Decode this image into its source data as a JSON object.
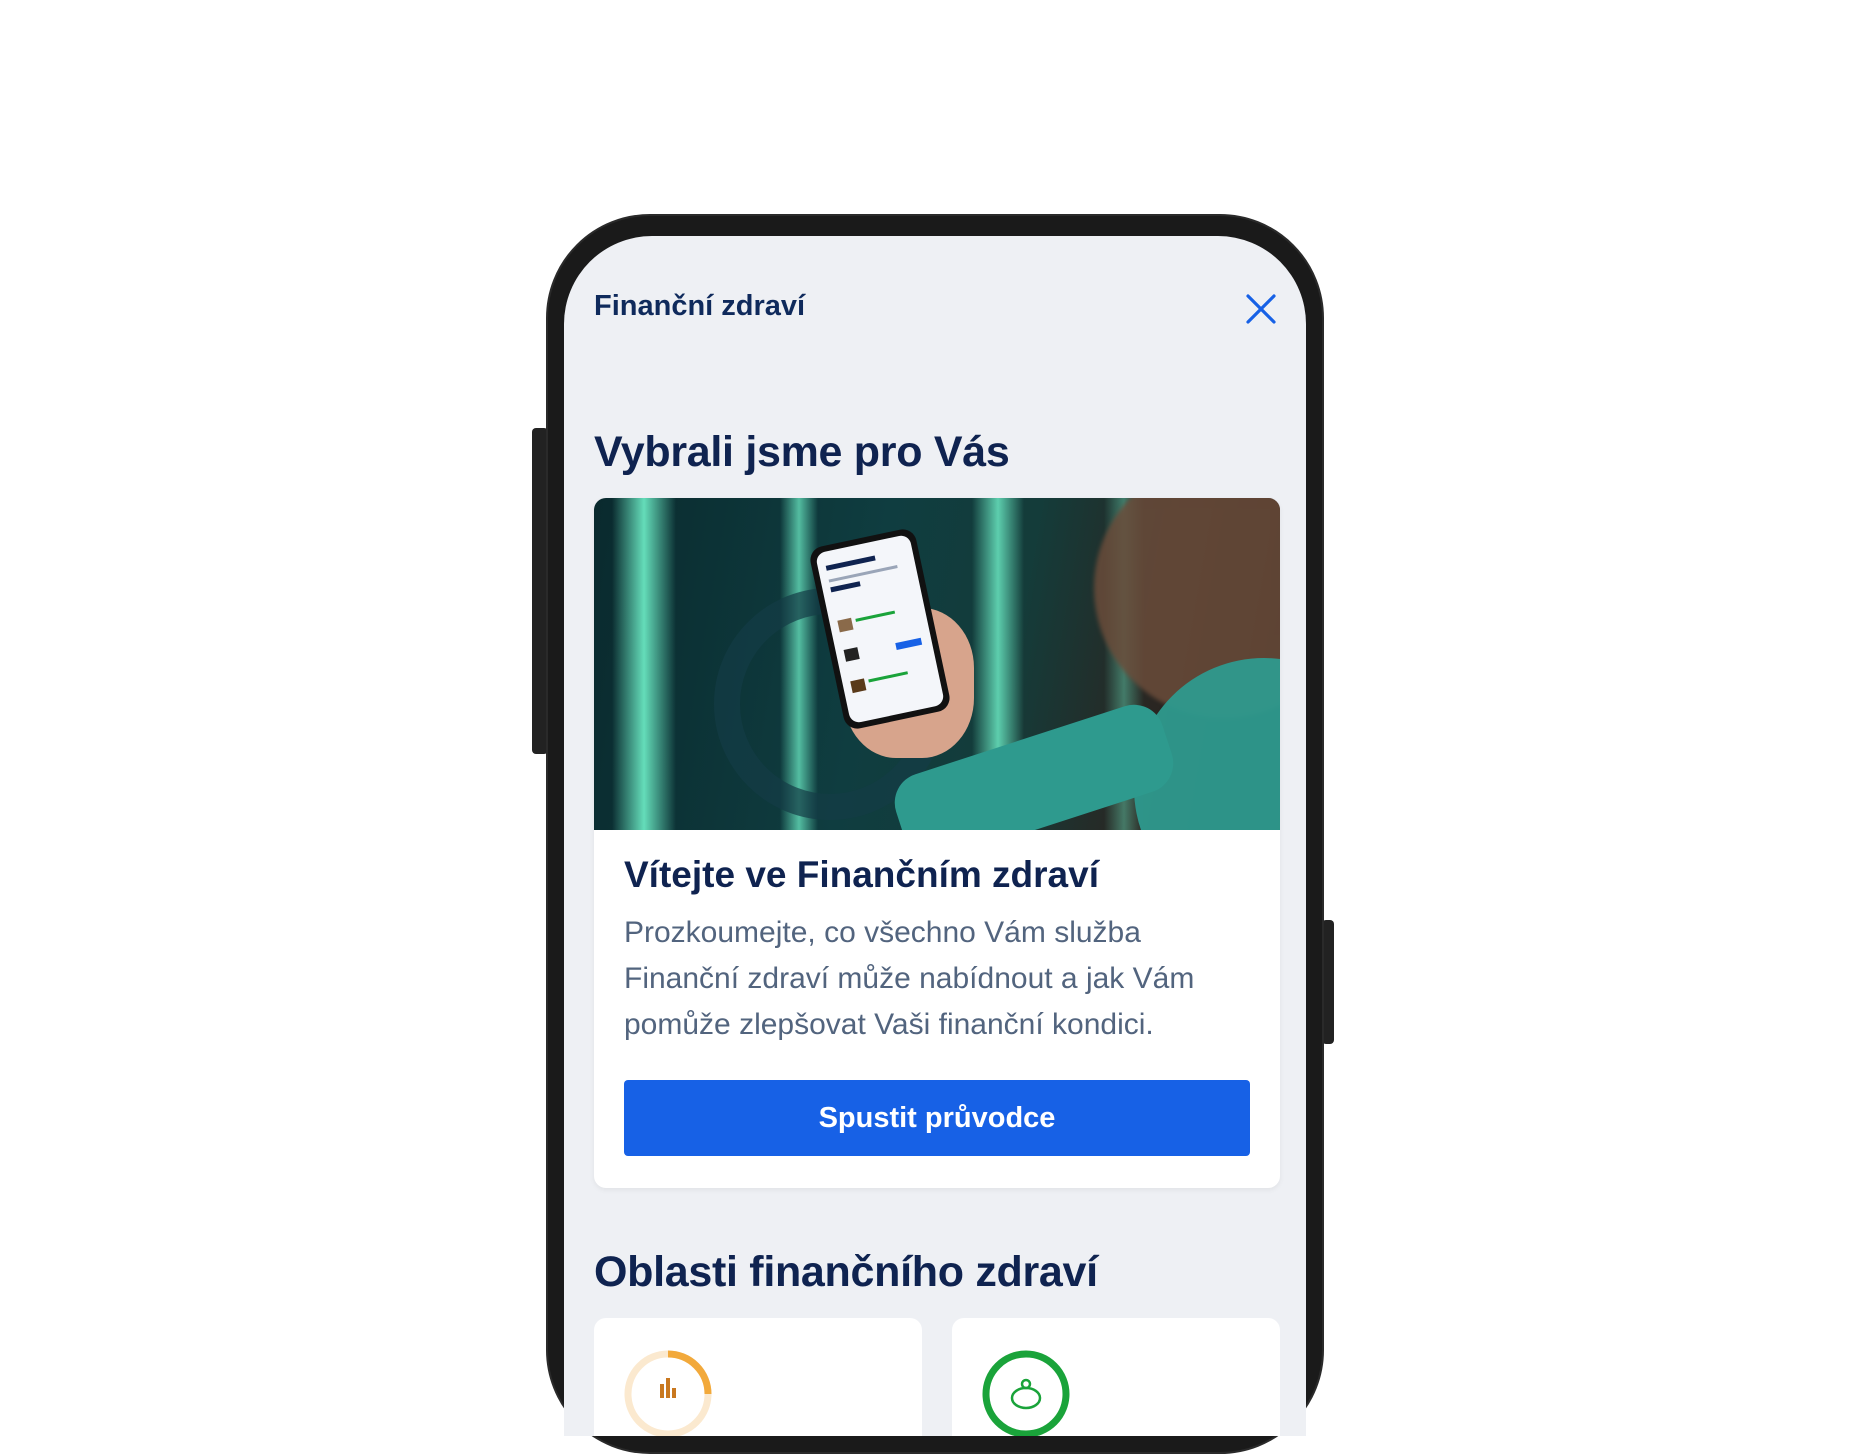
{
  "header": {
    "title": "Finanční zdraví",
    "close_icon": "close-icon"
  },
  "sections": {
    "recommended_title": "Vybrali jsme pro Vás",
    "areas_title": "Oblasti finančního zdraví"
  },
  "promo_card": {
    "title": "Vítejte ve Finančním zdraví",
    "text": "Prozkoumejte, co všechno Vám služba Finanční zdraví může nabídnout a jak Vám pomůže zlepšovat Vaši finanční kondici.",
    "button_label": "Spustit průvodce",
    "image": "hand-holding-phone-image"
  },
  "area_cards": [
    {
      "icon": "budget-chart-icon",
      "accent": "#f2a93b"
    },
    {
      "icon": "savings-piggy-icon",
      "accent": "#1aa33a"
    }
  ],
  "colors": {
    "primary": "#1761e6",
    "heading": "#0f2350",
    "background": "#eef0f4"
  }
}
